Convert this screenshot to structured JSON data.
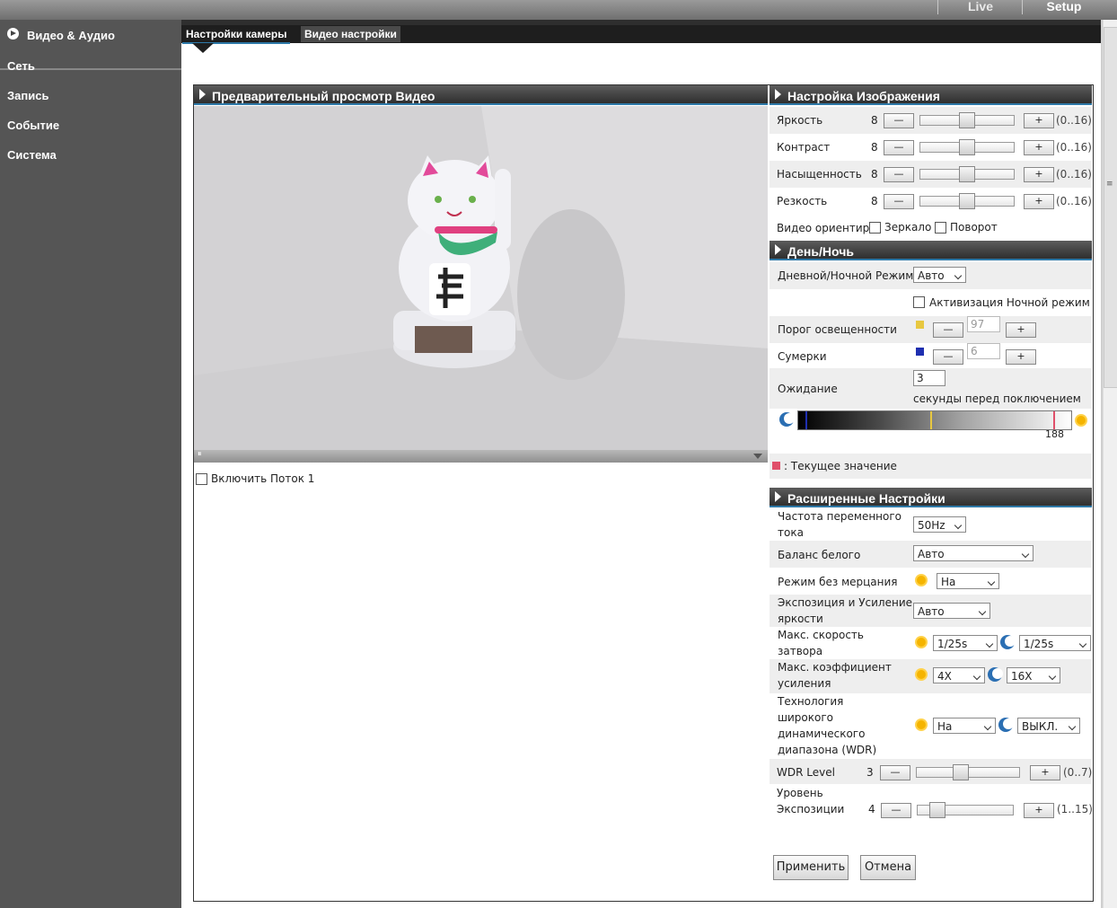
{
  "topnav": {
    "live": "Live",
    "setup": "Setup"
  },
  "sidebar": {
    "items": [
      {
        "label": "Видео & Аудио"
      },
      {
        "label": "Сеть"
      },
      {
        "label": "Запись"
      },
      {
        "label": "Событие"
      },
      {
        "label": "Система"
      }
    ]
  },
  "tabs": [
    {
      "label": "Настройки камеры"
    },
    {
      "label": "Видео настройки"
    }
  ],
  "preview": {
    "title": "Предварительный просмотр Видео",
    "pause_glyph": "⏸",
    "enable_stream": "Включить Поток 1"
  },
  "image": {
    "title": "Настройка Изображения",
    "rows": [
      {
        "label": "Яркость",
        "value": "8",
        "range": "(0..16)",
        "level": 0.5
      },
      {
        "label": "Контраст",
        "value": "8",
        "range": "(0..16)",
        "level": 0.5
      },
      {
        "label": "Насыщенность",
        "value": "8",
        "range": "(0..16)",
        "level": 0.5
      },
      {
        "label": "Резкость",
        "value": "8",
        "range": "(0..16)",
        "level": 0.5
      }
    ],
    "orientation_label": "Видео ориентир",
    "mirror": "Зеркало",
    "rotate": "Поворот"
  },
  "daynight": {
    "title": "День/Ночь",
    "mode_label": "Дневной/Ночной Режим",
    "mode_value": "Авто",
    "night_mode": "Активизация Ночной режим",
    "threshold_label": "Порог освещенности",
    "threshold_value": "97",
    "dusk_label": "Сумерки",
    "dusk_value": "6",
    "wait_label": "Ожидание",
    "wait_value": "3",
    "wait_note": "секунды перед поключением",
    "current_value": "188",
    "legend": ": Текущее значение",
    "colors": {
      "threshold": "#e8c840",
      "dusk": "#1f2fb0",
      "current": "#e0506a"
    }
  },
  "advanced": {
    "title": "Расширенные Настройки",
    "ac_label_1": "Частота переменного",
    "ac_label_2": "тока",
    "ac_value": "50Hz",
    "wb_label": "Баланс белого",
    "wb_value": "Авто",
    "flicker_label": "Режим без мерцания",
    "flicker_value": "На",
    "exposure_label_1": "Экспозиция и Усиление",
    "exposure_label_2": "яркости",
    "exposure_value": "Авто",
    "shutter_label_1": "Макс. скорость",
    "shutter_label_2": "затвора",
    "shutter_day": "1/25s",
    "shutter_night": "1/25s",
    "gain_label_1": "Макс. коэффициент",
    "gain_label_2": "усиления",
    "gain_day": "4X",
    "gain_night": "16X",
    "wdr_label_1": "Технология",
    "wdr_label_2": "широкого",
    "wdr_label_3": "динамического",
    "wdr_label_4": "диапазона (WDR)",
    "wdr_day": "На",
    "wdr_night": "ВЫКЛ.",
    "wdr_level_label": "WDR Level",
    "wdr_level_value": "3",
    "wdr_level_range": "(0..7)",
    "wdr_level_level": 0.43,
    "exp_level_label_1": "Уровень",
    "exp_level_label_2": "Экспозиции",
    "exp_level_value": "4",
    "exp_level_range": "(1..15)",
    "exp_level_level": 0.21
  },
  "buttons": {
    "apply": "Применить",
    "cancel": "Отмена",
    "minus": "—",
    "plus": "+"
  }
}
